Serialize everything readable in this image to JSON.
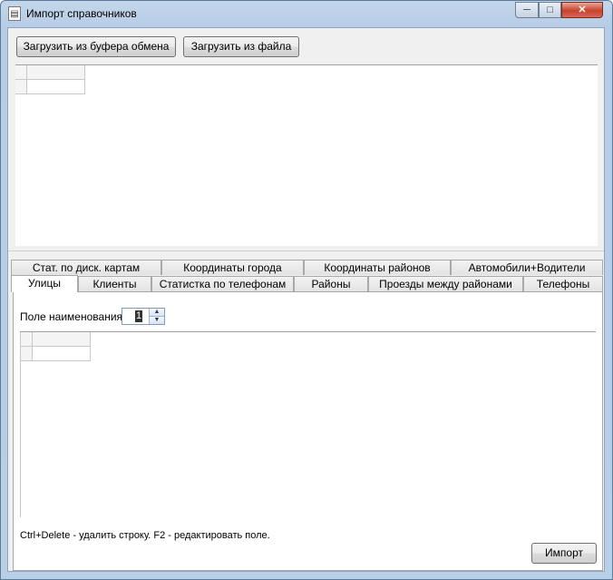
{
  "window": {
    "title": "Импорт справочников",
    "minimize_label": "─",
    "maximize_label": "□",
    "close_label": "✕"
  },
  "toolbar": {
    "load_clipboard_label": "Загрузить из буфера обмена",
    "load_file_label": "Загрузить из файла"
  },
  "tabs_row1": [
    "Стат. по диск. картам",
    "Координаты города",
    "Координаты районов",
    "Автомобили+Водители"
  ],
  "tabs_row2": [
    "Улицы",
    "Клиенты",
    "Статистка по телефонам",
    "Районы",
    "Проезды между районами",
    "Телефоны"
  ],
  "active_tab": "Улицы",
  "panel": {
    "name_field_label": "Поле наименования:",
    "name_field_value": "1",
    "hint": "Ctrl+Delete - удалить строку. F2 - редактировать поле.",
    "import_label": "Импорт"
  },
  "colors": {
    "title_gradient_top": "#c4d6ea",
    "close_button": "#c8422b",
    "client_bg": "#f0f0f0"
  }
}
